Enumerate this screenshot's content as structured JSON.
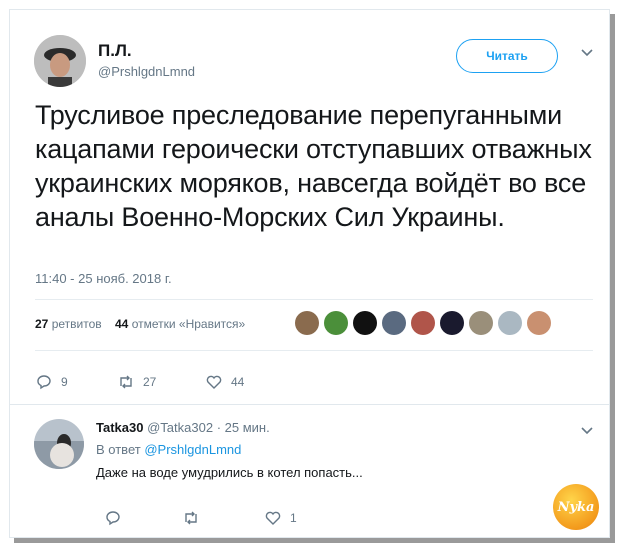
{
  "tweet": {
    "author_name": "П.Л.",
    "author_handle": "@PrshlgdnLmnd",
    "follow_label": "Читать",
    "text": "Трусливое преследование перепуганными кацапами героически отступавших отважных украинских моряков, навсегда войдёт во все  аналы Военно-Морских Сил Украины.",
    "timestamp": "11:40 - 25 нояб. 2018 г.",
    "retweets_count": "27",
    "retweets_label": "ретвитов",
    "likes_count": "44",
    "likes_label": "отметки «Нравится»",
    "likers": [
      {
        "name": "liker-1",
        "color": "#8a6b4e"
      },
      {
        "name": "liker-2",
        "color": "#4b8f3a"
      },
      {
        "name": "liker-3",
        "color": "#111111"
      },
      {
        "name": "liker-4",
        "color": "#5a6a80"
      },
      {
        "name": "liker-5",
        "color": "#b0554a"
      },
      {
        "name": "liker-6",
        "color": "#1a1a2e"
      },
      {
        "name": "liker-7",
        "color": "#9a8f7a"
      },
      {
        "name": "liker-8",
        "color": "#aab8c2"
      },
      {
        "name": "liker-9",
        "color": "#c99070"
      }
    ],
    "actions": {
      "replies": "9",
      "retweets": "27",
      "likes": "44"
    }
  },
  "reply": {
    "author_name": "Tatka30",
    "author_handle": "@Tatka302",
    "time": "· 25 мин.",
    "in_reply_prefix": "В ответ",
    "in_reply_handle": "@PrshlgdnLmnd",
    "text": "Даже на воде умудрились в котел попасть...",
    "actions": {
      "replies": "",
      "retweets": "",
      "likes": "1"
    }
  },
  "watermark": "Nyka",
  "colors": {
    "accent": "#1da1f2",
    "secondary_text": "#657786",
    "divider": "#e6ecf0"
  }
}
